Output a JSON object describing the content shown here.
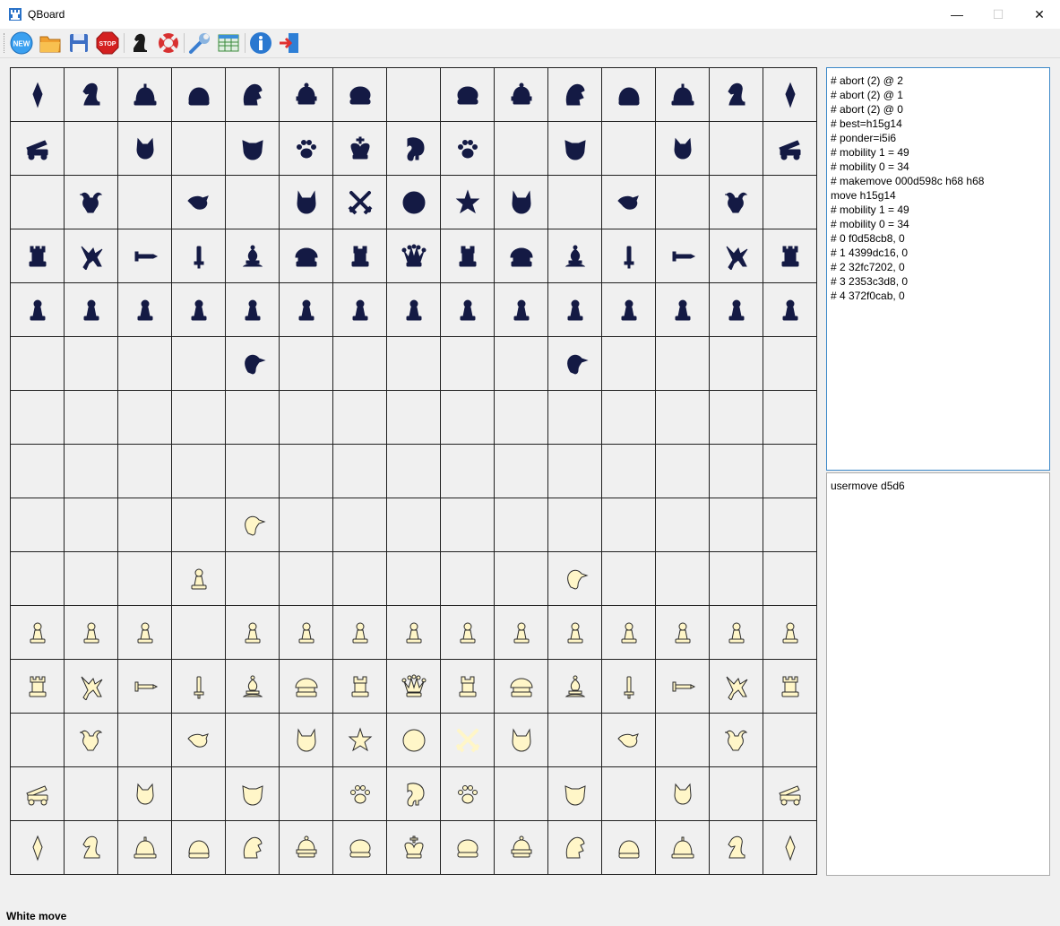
{
  "window": {
    "title": "QBoard",
    "minimize_glyph": "—",
    "maximize_glyph": "☐",
    "close_glyph": "✕"
  },
  "toolbar": [
    {
      "name": "new-game-button",
      "icon": "new-icon",
      "label": "NEW"
    },
    {
      "name": "open-button",
      "icon": "folder-open-icon"
    },
    {
      "name": "save-button",
      "icon": "floppy-disk-icon"
    },
    {
      "name": "stop-button",
      "icon": "stop-sign-icon",
      "label": "STOP"
    },
    {
      "name": "engine-button",
      "icon": "chess-knight-icon"
    },
    {
      "name": "help-button",
      "icon": "life-ring-icon"
    },
    {
      "name": "settings-button",
      "icon": "wrench-icon"
    },
    {
      "name": "table-button",
      "icon": "table-icon"
    },
    {
      "name": "about-button",
      "icon": "info-icon"
    },
    {
      "name": "exit-button",
      "icon": "exit-door-icon"
    }
  ],
  "board": {
    "files": 15,
    "ranks": 15,
    "colors": {
      "dark": "#141a44",
      "light": "#fff6c8",
      "light_outline": "#2b2b2b"
    },
    "rows": [
      [
        "marshal",
        "knight",
        "bell-helmet",
        "dome-helmet",
        "warrior-helmet",
        "crown-helmet",
        "capped-helmet",
        "",
        "capped-helmet",
        "crown-helmet",
        "warrior-helmet",
        "dome-helmet",
        "bell-helmet",
        "knight",
        "marshal"
      ],
      [
        "cannon",
        "",
        "cat",
        "",
        "wildcat",
        "paw",
        "king",
        "elephant",
        "paw",
        "",
        "wildcat",
        "",
        "cat",
        "",
        "cannon"
      ],
      [
        "",
        "gnu",
        "",
        "hawk",
        "",
        "wolf",
        "crossed-swords",
        "lion",
        "star",
        "wolf",
        "",
        "hawk",
        "",
        "gnu",
        ""
      ],
      [
        "rook",
        "dragon",
        "sword-h",
        "sword-v",
        "bishop",
        "cardinal",
        "chancellor",
        "queen",
        "chancellor",
        "cardinal",
        "bishop",
        "sword-v",
        "sword-h",
        "dragon",
        "rook"
      ],
      [
        "pawn",
        "pawn",
        "pawn",
        "pawn",
        "pawn",
        "pawn",
        "pawn",
        "pawn",
        "pawn",
        "pawn",
        "pawn",
        "pawn",
        "pawn",
        "pawn",
        "pawn"
      ],
      [
        "",
        "",
        "",
        "",
        "goose",
        "",
        "",
        "",
        "",
        "",
        "goose",
        "",
        "",
        "",
        ""
      ],
      [
        "",
        "",
        "",
        "",
        "",
        "",
        "",
        "",
        "",
        "",
        "",
        "",
        "",
        "",
        ""
      ],
      [
        "",
        "",
        "",
        "",
        "",
        "",
        "",
        "",
        "",
        "",
        "",
        "",
        "",
        "",
        ""
      ],
      [
        "",
        "",
        "",
        "",
        "goose",
        "",
        "",
        "",
        "",
        "",
        "",
        "",
        "",
        "",
        ""
      ],
      [
        "",
        "",
        "",
        "pawn",
        "",
        "",
        "",
        "",
        "",
        "",
        "goose",
        "",
        "",
        "",
        ""
      ],
      [
        "pawn",
        "pawn",
        "pawn",
        "",
        "pawn",
        "pawn",
        "pawn",
        "pawn",
        "pawn",
        "pawn",
        "pawn",
        "pawn",
        "pawn",
        "pawn",
        "pawn"
      ],
      [
        "rook",
        "dragon",
        "sword-h",
        "sword-v",
        "bishop",
        "cardinal",
        "chancellor",
        "queen",
        "chancellor",
        "cardinal",
        "bishop",
        "sword-v",
        "sword-h",
        "dragon",
        "rook"
      ],
      [
        "",
        "gnu",
        "",
        "hawk",
        "",
        "wolf",
        "star",
        "lion",
        "crossed-swords",
        "wolf",
        "",
        "hawk",
        "",
        "gnu",
        ""
      ],
      [
        "cannon",
        "",
        "cat",
        "",
        "wildcat",
        "",
        "paw",
        "elephant",
        "paw",
        "",
        "wildcat",
        "",
        "cat",
        "",
        "cannon"
      ],
      [
        "marshal",
        "knight",
        "bell-helmet",
        "dome-helmet",
        "warrior-helmet",
        "crown-helmet",
        "capped-helmet",
        "king",
        "capped-helmet",
        "crown-helmet",
        "warrior-helmet",
        "dome-helmet",
        "bell-helmet",
        "knight",
        "marshal"
      ]
    ]
  },
  "engine_log": [
    "# abort (2) @ 2",
    "# abort (2) @ 1",
    "# abort (2) @ 0",
    "# best=h15g14",
    "# ponder=i5i6",
    "# mobility 1 = 49",
    "# mobility 0 = 34",
    "# makemove 000d598c h68 h68",
    "move h15g14",
    "# mobility 1 = 49",
    "# mobility 0 = 34",
    "# 0 f0d58cb8, 0",
    "# 1 4399dc16, 0",
    "# 2 32fc7202, 0",
    "# 3 2353c3d8, 0",
    "# 4 372f0cab, 0"
  ],
  "command_input": "usermove d5d6",
  "status": "White move"
}
